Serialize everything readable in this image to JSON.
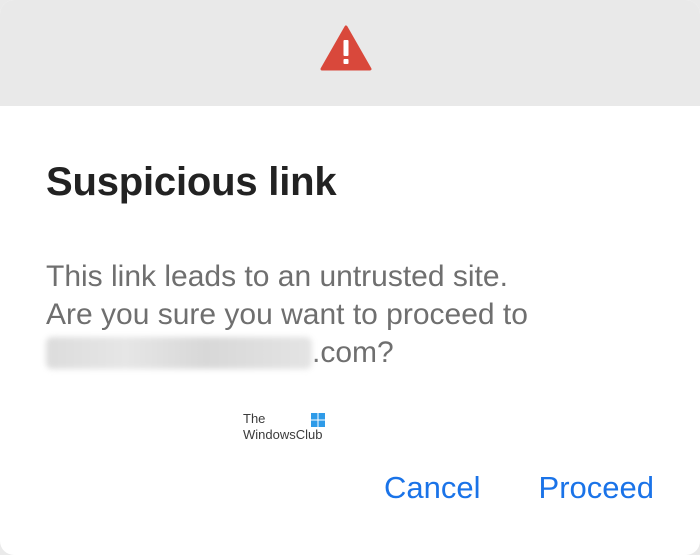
{
  "dialog": {
    "header": {
      "icon": "warning-triangle-icon",
      "icon_color": "#d9483b"
    },
    "title": "Suspicious link",
    "body": {
      "line1": "This link leads to an untrusted site.",
      "line2": "Are you sure you want to proceed to",
      "url_suffix": ".com?"
    },
    "buttons": {
      "cancel_label": "Cancel",
      "proceed_label": "Proceed"
    },
    "accent_color": "#1a73e8"
  },
  "watermark": {
    "line1": "The",
    "line2": "WindowsClub",
    "icon": "windows-logo-icon"
  }
}
